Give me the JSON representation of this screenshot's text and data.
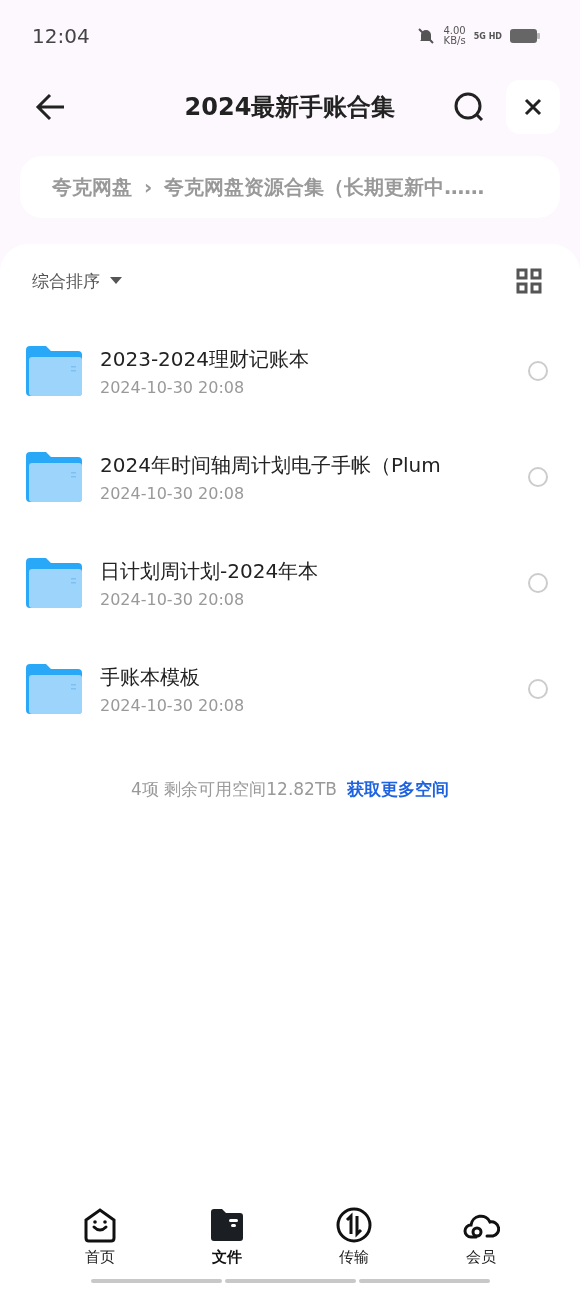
{
  "status_bar": {
    "time": "12:04",
    "speed": "4.00",
    "speed_unit": "KB/s",
    "network": "5G HD"
  },
  "header": {
    "title": "2024最新手账合集"
  },
  "breadcrumb": {
    "items": [
      "夸克网盘",
      "夸克网盘资源合集（长期更新中……"
    ],
    "separator": "›"
  },
  "toolbar": {
    "sort_label": "综合排序"
  },
  "files": [
    {
      "name": "2023-2024理财记账本",
      "date": "2024-10-30 20:08",
      "checked": false
    },
    {
      "name": "2024年时间轴周计划电子手帐（Plum",
      "date": "2024-10-30 20:08",
      "checked": false
    },
    {
      "name": "日计划周计划-2024年本",
      "date": "2024-10-30 20:08",
      "checked": false
    },
    {
      "name": "手账本模板",
      "date": "2024-10-30 20:08",
      "checked": false
    }
  ],
  "footer": {
    "summary": "4项 剩余可用空间12.82TB",
    "link": "获取更多空间"
  },
  "tabs": [
    {
      "label": "首页",
      "kind": "home",
      "selected": false
    },
    {
      "label": "文件",
      "kind": "files",
      "selected": true
    },
    {
      "label": "传输",
      "kind": "transfer",
      "selected": false
    },
    {
      "label": "会员",
      "kind": "member",
      "selected": false
    }
  ]
}
